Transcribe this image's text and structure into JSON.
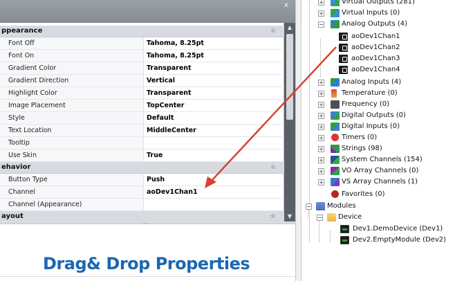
{
  "properties_panel": {
    "close_glyph": "x",
    "categories": [
      {
        "label": "ppearance",
        "collapse_glyph": "☆",
        "rows": [
          {
            "name": "Font Off",
            "value": "Tahoma, 8.25pt"
          },
          {
            "name": "Font On",
            "value": "Tahoma, 8.25pt"
          },
          {
            "name": "Gradient Color",
            "value": "Transparent"
          },
          {
            "name": "Gradient Direction",
            "value": "Vertical"
          },
          {
            "name": "Highlight Color",
            "value": "Transparent"
          },
          {
            "name": "Image Placement",
            "value": "TopCenter"
          },
          {
            "name": "Style",
            "value": "Default"
          },
          {
            "name": "Text Location",
            "value": "MiddleCenter"
          },
          {
            "name": "Tooltip",
            "value": ""
          },
          {
            "name": "Use Skin",
            "value": "True"
          }
        ]
      },
      {
        "label": "ehavior",
        "collapse_glyph": "☆",
        "rows": [
          {
            "name": "Button Type",
            "value": "Push"
          },
          {
            "name": "Channel",
            "value": "aoDev1Chan1"
          },
          {
            "name": "Channel (Appearance)",
            "value": ""
          }
        ]
      },
      {
        "label": "ayout",
        "collapse_glyph": "☆",
        "rows": []
      }
    ],
    "scroll_up_glyph": "▲",
    "scroll_down_glyph": "▼",
    "splitter_grip": "....."
  },
  "caption": "Drag& Drop Properties",
  "tree": {
    "expand_glyph": "+",
    "collapse_glyph": "−",
    "nodes": [
      {
        "label": "Virtual Outputs (281)",
        "icon": "virtual-outputs-icon"
      },
      {
        "label": "Virtual Inputs (0)",
        "icon": "virtual-inputs-icon"
      },
      {
        "label": "Analog Outputs (4)",
        "icon": "analog-outputs-icon"
      },
      {
        "label": "aoDev1Chan1",
        "icon": "channel-icon"
      },
      {
        "label": "aoDev1Chan2",
        "icon": "channel-icon"
      },
      {
        "label": "aoDev1Chan3",
        "icon": "channel-icon"
      },
      {
        "label": "aoDev1Chan4",
        "icon": "channel-icon"
      },
      {
        "label": "Analog Inputs (4)",
        "icon": "analog-inputs-icon"
      },
      {
        "label": "Temperature (0)",
        "icon": "thermometer-icon"
      },
      {
        "label": "Frequency (0)",
        "icon": "frequency-icon"
      },
      {
        "label": "Digital Outputs (0)",
        "icon": "digital-outputs-icon"
      },
      {
        "label": "Digital Inputs (0)",
        "icon": "digital-inputs-icon"
      },
      {
        "label": "Timers (0)",
        "icon": "timer-icon"
      },
      {
        "label": "Strings (98)",
        "icon": "strings-icon"
      },
      {
        "label": "System Channels (154)",
        "icon": "system-channels-icon"
      },
      {
        "label": "VO Array Channels (0)",
        "icon": "vo-array-icon"
      },
      {
        "label": "VS Array Channels (1)",
        "icon": "vs-array-icon"
      },
      {
        "label": "Favorites (0)",
        "icon": "favorites-icon"
      },
      {
        "label": "Modules",
        "icon": "modules-icon"
      },
      {
        "label": "Device",
        "icon": "folder-icon"
      },
      {
        "label": "Dev1.DemoDevice (Dev1)",
        "icon": "device-icon"
      },
      {
        "label": "Dev2.EmptyModule (Dev2)",
        "icon": "device-icon"
      }
    ]
  },
  "colors": {
    "caption": "#1b67b2",
    "arrow": "#d8432f",
    "category_bg": "#d7dbe1",
    "scrollbar": "#5b6068"
  }
}
